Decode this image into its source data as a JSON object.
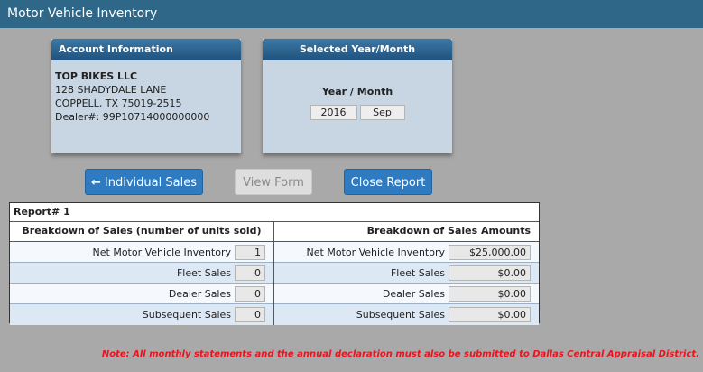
{
  "window": {
    "title": "Motor Vehicle Inventory"
  },
  "account": {
    "header": "Account Information",
    "company": "TOP BIKES LLC",
    "address1": "128 SHADYDALE LANE",
    "address2": "COPPELL, TX 75019-2515",
    "dealer": "Dealer#: 99P10714000000000"
  },
  "period": {
    "header": "Selected Year/Month",
    "label": "Year / Month",
    "year": "2016",
    "month": "Sep"
  },
  "buttons": {
    "arrow_icon": "arrow-left-icon",
    "individual_sales": "Individual Sales",
    "view_form": "View Form",
    "close_report": "Close Report"
  },
  "report": {
    "title": "Report# 1",
    "left_header": "Breakdown of Sales (number of units sold)",
    "right_header": "Breakdown of Sales Amounts",
    "rows": [
      {
        "label": "Net Motor Vehicle Inventory",
        "units": "1",
        "amount": "$25,000.00"
      },
      {
        "label": "Fleet Sales",
        "units": "0",
        "amount": "$0.00"
      },
      {
        "label": "Dealer Sales",
        "units": "0",
        "amount": "$0.00"
      },
      {
        "label": "Subsequent Sales",
        "units": "0",
        "amount": "$0.00"
      }
    ]
  },
  "note": "Note: All monthly statements and the annual declaration must also be submitted to Dallas Central Appraisal District.",
  "colors": {
    "titlebar": "#2f6788",
    "button": "#2f7bc1",
    "note": "#e8141e"
  }
}
